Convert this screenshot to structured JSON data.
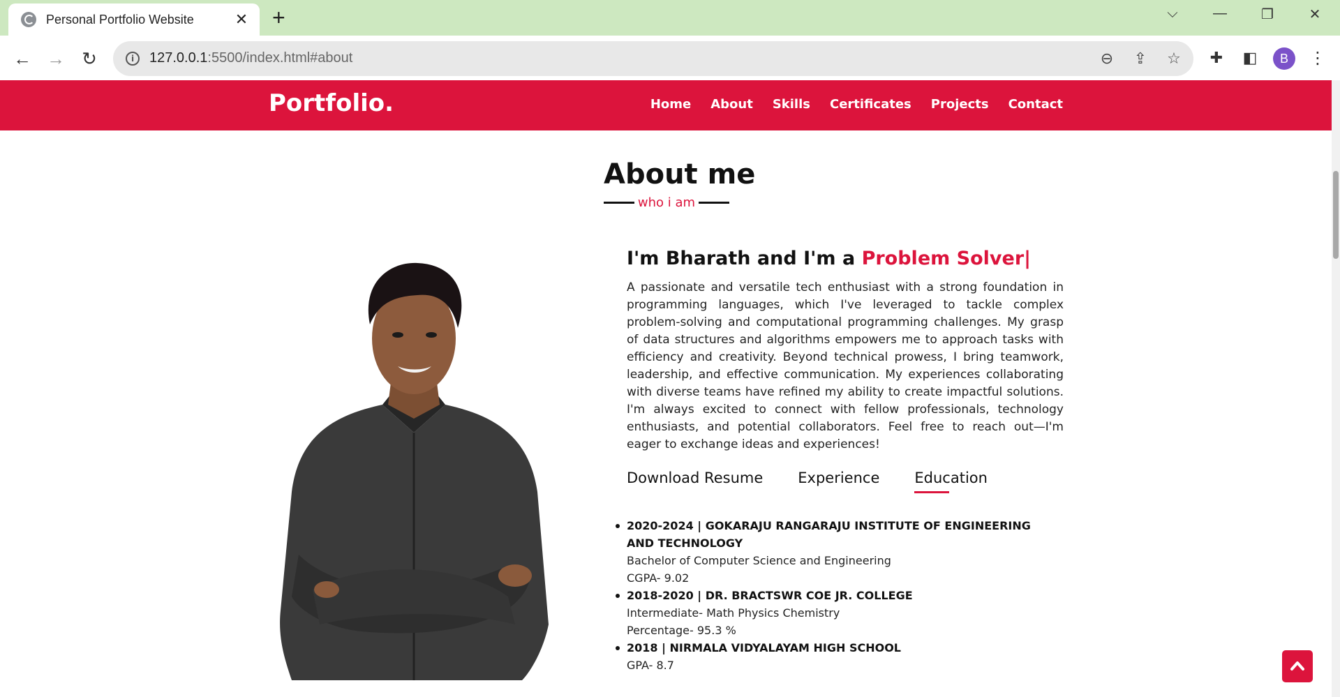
{
  "browser": {
    "tab_title": "Personal Portfolio Website",
    "url_host": "127.0.0.1",
    "url_rest": ":5500/index.html#about"
  },
  "site": {
    "logo": "Portfolio.",
    "nav": [
      "Home",
      "About",
      "Skills",
      "Certificates",
      "Projects",
      "Contact"
    ]
  },
  "about": {
    "title": "About me",
    "subtitle": "who i am",
    "headline_prefix": "I'm Bharath and I'm a ",
    "headline_accent": "Problem Solver|",
    "paragraph": "A passionate and versatile tech enthusiast with a strong foundation in programming languages, which I've leveraged to tackle complex problem-solving and computational programming challenges. My grasp of data structures and algorithms empowers me to approach tasks with efficiency and creativity. Beyond technical prowess, I bring teamwork, leadership, and effective communication. My experiences collaborating with diverse teams have refined my ability to create impactful solutions. I'm always excited to connect with fellow professionals, technology enthusiasts, and potential collaborators. Feel free to reach out—I'm eager to exchange ideas and experiences!",
    "tabs": [
      "Download Resume",
      "Experience",
      "Education"
    ],
    "active_tab": "Education",
    "education": [
      {
        "heading": "2020-2024 | GOKARAJU RANGARAJU INSTITUTE OF ENGINEERING AND TECHNOLOGY",
        "lines": [
          "Bachelor of Computer Science and Engineering",
          "CGPA- 9.02"
        ]
      },
      {
        "heading": "2018-2020 | DR. BRACTSWR COE JR. COLLEGE",
        "lines": [
          "Intermediate- Math Physics Chemistry",
          "Percentage- 95.3 %"
        ]
      },
      {
        "heading": "2018 | NIRMALA VIDYALAYAM HIGH SCHOOL",
        "lines": [
          "GPA- 8.7"
        ]
      }
    ]
  },
  "profile_avatar_letter": "B",
  "colors": {
    "accent": "#dc143c",
    "tabbar": "#cde8c0"
  }
}
